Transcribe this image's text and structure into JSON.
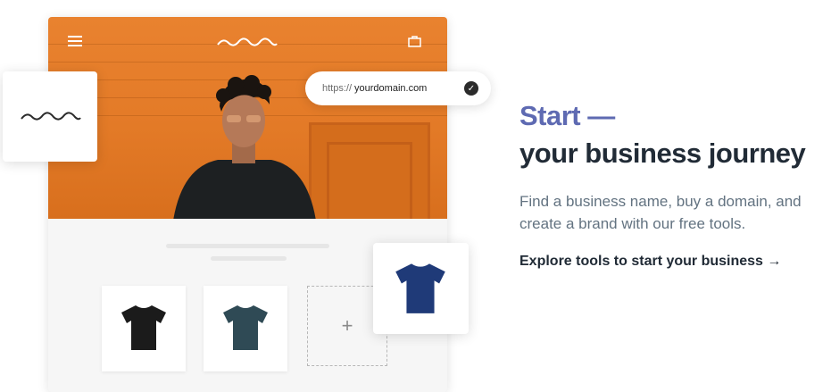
{
  "url_card": {
    "protocol": "https://",
    "domain": "yourdomain.com",
    "check_icon": "check-circle-icon"
  },
  "hero": {
    "menu_icon": "hamburger-menu-icon",
    "logo_icon": "wave-logo-icon",
    "cart_icon": "shopping-bag-icon",
    "background_color": "#e37a27"
  },
  "products": [
    {
      "icon": "tshirt-icon",
      "color": "#1b1b1b"
    },
    {
      "icon": "tshirt-icon",
      "color": "#2f4a55"
    }
  ],
  "add_product": {
    "label": "+"
  },
  "featured_product": {
    "icon": "tshirt-icon",
    "color": "#1f3a78"
  },
  "headline": {
    "accent": "Start —",
    "main": "your business journey"
  },
  "description": "Find a business name, buy a domain, and create a brand with our free tools.",
  "cta": {
    "label": "Explore tools to start your business →"
  },
  "colors": {
    "accent": "#5e6ab2",
    "text": "#212b36",
    "muted": "#637381"
  }
}
